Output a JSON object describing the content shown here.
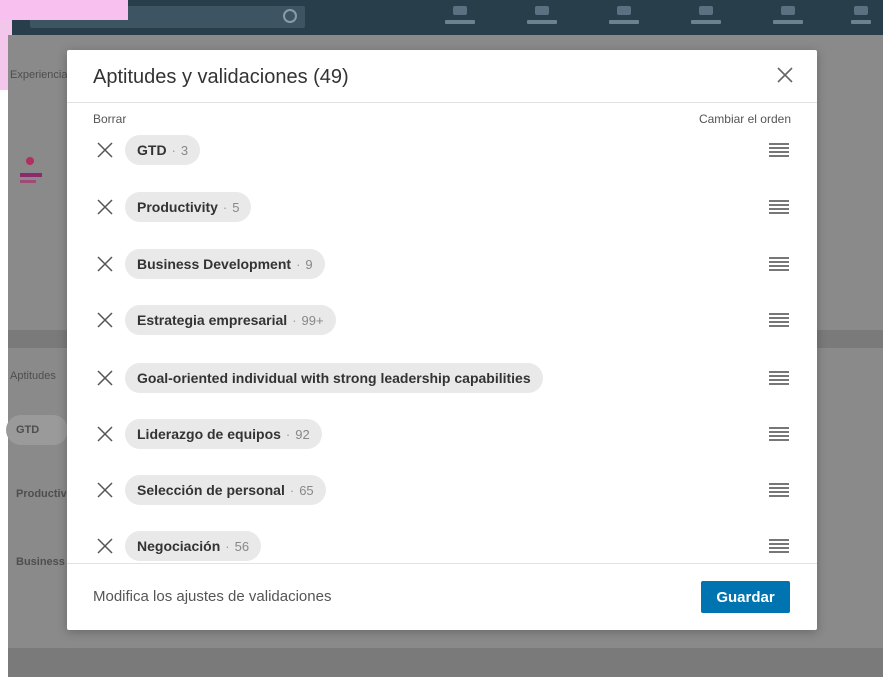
{
  "background": {
    "section_experience": "Experiencia",
    "section_skills": "Aptitudes",
    "skills_preview": [
      "GTD",
      "Productivity",
      "Business Development"
    ],
    "nav_items": [
      "Inicio",
      "Mi red",
      "Empleos",
      "Mensajes",
      "Notificaciones",
      "Yo"
    ]
  },
  "modal": {
    "title": "Aptitudes y validaciones (49)",
    "remove_column_label": "Borrar",
    "reorder_column_label": "Cambiar el orden",
    "skills": [
      {
        "name": "GTD",
        "separator": "·",
        "count": "3"
      },
      {
        "name": "Productivity",
        "separator": "·",
        "count": "5"
      },
      {
        "name": "Business Development",
        "separator": "·",
        "count": "9"
      },
      {
        "name": "Estrategia empresarial",
        "separator": "·",
        "count": "99+"
      },
      {
        "name": "Goal-oriented individual with strong leadership capabilities",
        "separator": "",
        "count": ""
      },
      {
        "name": "Liderazgo de equipos",
        "separator": "·",
        "count": "92"
      },
      {
        "name": "Selección de personal",
        "separator": "·",
        "count": "65"
      },
      {
        "name": "Negociación",
        "separator": "·",
        "count": "56"
      }
    ],
    "footer_link": "Modifica los ajustes de validaciones",
    "save_label": "Guardar"
  },
  "colors": {
    "accent": "#0073b1",
    "overlay": "#7a7a7a",
    "pill": "#e9e9e9",
    "topbar": "#283e4a"
  },
  "icons": {
    "close": "close-icon",
    "remove": "remove-x-icon",
    "reorder": "drag-handle-icon",
    "search": "search-icon"
  }
}
